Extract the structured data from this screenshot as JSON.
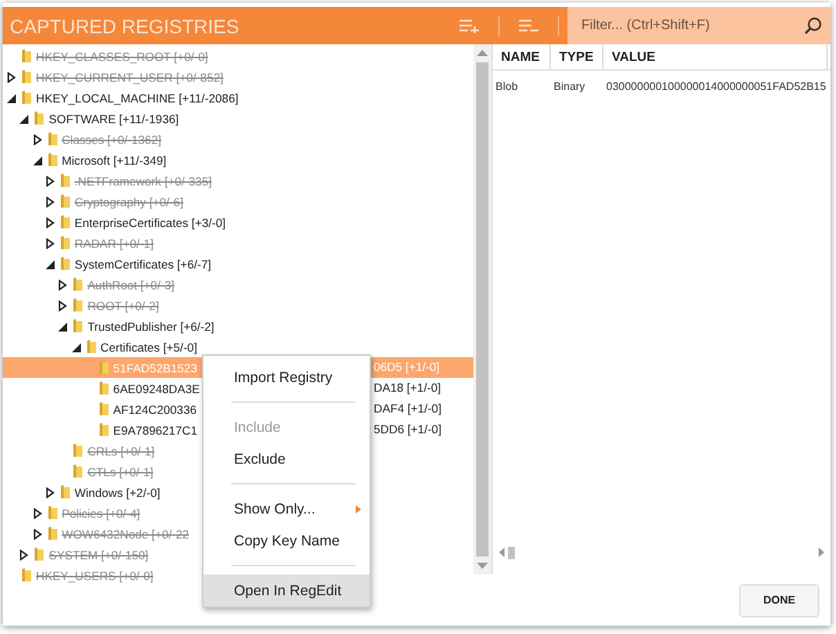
{
  "header": {
    "title": "CAPTURED REGISTRIES",
    "filter": {
      "placeholder": "Filter... (Ctrl+Shift+F)"
    }
  },
  "tree": [
    {
      "label": "HKEY_CLASSES_ROOT [+0/-0]",
      "excluded": true,
      "selected": false
    },
    {
      "label": "HKEY_CURRENT_USER [+0/-852]",
      "excluded": true,
      "expanded": false,
      "selected": false
    },
    {
      "label": "HKEY_LOCAL_MACHINE [+11/-2086]",
      "excluded": false,
      "expanded": true,
      "selected": false,
      "children": [
        {
          "label": "SOFTWARE [+11/-1936]",
          "excluded": false,
          "expanded": true,
          "selected": false,
          "children": [
            {
              "label": "Classes [+0/-1362]",
              "excluded": true,
              "expanded": false,
              "selected": false
            },
            {
              "label": "Microsoft [+11/-349]",
              "excluded": false,
              "expanded": true,
              "selected": false,
              "children": [
                {
                  "label": ".NETFramework [+0/-335]",
                  "excluded": true,
                  "expanded": false,
                  "selected": false
                },
                {
                  "label": "Cryptography [+0/-6]",
                  "excluded": true,
                  "expanded": false,
                  "selected": false
                },
                {
                  "label": "EnterpriseCertificates [+3/-0]",
                  "excluded": false,
                  "expanded": false,
                  "selected": false
                },
                {
                  "label": "RADAR [+0/-1]",
                  "excluded": true,
                  "expanded": false,
                  "selected": false
                },
                {
                  "label": "SystemCertificates [+6/-7]",
                  "excluded": false,
                  "expanded": true,
                  "selected": false,
                  "children": [
                    {
                      "label": "AuthRoot [+0/-3]",
                      "excluded": true,
                      "expanded": false,
                      "selected": false
                    },
                    {
                      "label": "ROOT [+0/-2]",
                      "excluded": true,
                      "expanded": false,
                      "selected": false
                    },
                    {
                      "label": "TrustedPublisher [+6/-2]",
                      "excluded": false,
                      "expanded": true,
                      "selected": false,
                      "children": [
                        {
                          "label": "Certificates [+5/-0]",
                          "excluded": false,
                          "expanded": true,
                          "selected": false,
                          "children": [
                            {
                              "label": "51FAD52B1523",
                              "tail": "06D5 [+1/-0]",
                              "excluded": false,
                              "selected": true
                            },
                            {
                              "label": "6AE09248DA3E",
                              "tail": "DA18 [+1/-0]",
                              "excluded": false,
                              "selected": false
                            },
                            {
                              "label": "AF124C200336",
                              "tail": "DAF4 [+1/-0]",
                              "excluded": false,
                              "selected": false
                            },
                            {
                              "label": "E9A7896217C1",
                              "tail": "5DD6 [+1/-0]",
                              "excluded": false,
                              "selected": false
                            }
                          ]
                        }
                      ]
                    },
                    {
                      "label": "CRLs [+0/-1]",
                      "excluded": true,
                      "selected": false
                    },
                    {
                      "label": "CTLs [+0/-1]",
                      "excluded": true,
                      "selected": false
                    }
                  ]
                },
                {
                  "label": "Windows [+2/-0]",
                  "excluded": false,
                  "expanded": false,
                  "selected": false
                }
              ]
            },
            {
              "label": "Policies [+0/-4]",
              "excluded": true,
              "expanded": false,
              "selected": false
            },
            {
              "label": "WOW6432Node [+0/-22",
              "excluded": true,
              "expanded": false,
              "selected": false
            }
          ]
        },
        {
          "label": "SYSTEM [+0/-150]",
          "excluded": true,
          "expanded": false,
          "selected": false
        }
      ]
    },
    {
      "label": "HKEY_USERS [+0/-0]",
      "excluded": true,
      "selected": false
    }
  ],
  "menu": [
    {
      "kind": "item",
      "label": "Import Registry",
      "disabled": false,
      "selected": false,
      "submenu": false
    },
    {
      "kind": "separator"
    },
    {
      "kind": "item",
      "label": "Include",
      "disabled": true,
      "selected": false,
      "submenu": false
    },
    {
      "kind": "item",
      "label": "Exclude",
      "disabled": false,
      "selected": false,
      "submenu": false
    },
    {
      "kind": "separator"
    },
    {
      "kind": "item",
      "label": "Show Only...",
      "disabled": false,
      "selected": false,
      "submenu": true
    },
    {
      "kind": "item",
      "label": "Copy Key Name",
      "disabled": false,
      "selected": false,
      "submenu": false
    },
    {
      "kind": "separator"
    },
    {
      "kind": "item",
      "label": "Open In RegEdit",
      "disabled": false,
      "selected": true,
      "submenu": false
    }
  ],
  "values": {
    "columns": [
      "NAME",
      "TYPE",
      "VALUE"
    ],
    "rows": [
      [
        "Blob",
        "Binary",
        "030000000100000014000000051FAD52B15"
      ]
    ]
  },
  "done_button": "DONE"
}
